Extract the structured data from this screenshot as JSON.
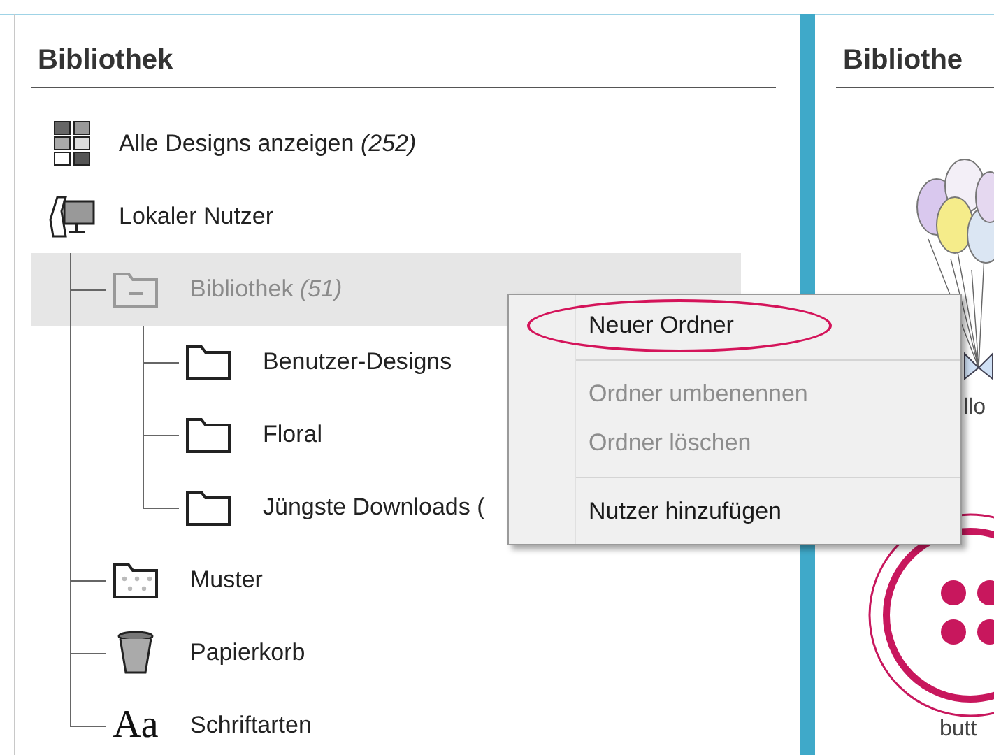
{
  "library_panel": {
    "title": "Bibliothek",
    "tree": [
      {
        "label": "Alle Designs anzeigen *(252)*",
        "kind": "grid",
        "selected": false
      },
      {
        "label": "Lokaler Nutzer",
        "kind": "computer",
        "selected": false,
        "children": [
          {
            "label": "Bibliothek *(51)*",
            "kind": "folder_minus",
            "selected": true,
            "children": [
              {
                "label": "Benutzer-Designs",
                "kind": "folder",
                "selected": false
              },
              {
                "label": "Floral",
                "kind": "folder",
                "selected": false
              },
              {
                "label": "Jüngste Downloads (",
                "kind": "folder",
                "selected": false
              }
            ]
          },
          {
            "label": "Muster",
            "kind": "pattern_folder",
            "selected": false
          },
          {
            "label": "Papierkorb",
            "kind": "trash",
            "selected": false
          },
          {
            "label": "Schriftarten",
            "kind": "font",
            "icon_text": "Aa",
            "selected": false
          }
        ]
      }
    ]
  },
  "designs_panel": {
    "title": "Bibliothe",
    "designs": [
      {
        "label": "llo",
        "kind": "balloons"
      },
      {
        "label": "butt",
        "kind": "button"
      }
    ]
  },
  "context_menu": [
    {
      "kind": "item",
      "label": "Neuer Ordner",
      "disabled": false,
      "circled": true
    },
    {
      "kind": "separator"
    },
    {
      "kind": "item",
      "label": "Ordner umbenennen",
      "disabled": true,
      "circled": false
    },
    {
      "kind": "item",
      "label": "Ordner löschen",
      "disabled": true,
      "circled": false
    },
    {
      "kind": "separator"
    },
    {
      "kind": "item",
      "label": "Nutzer hinzufügen",
      "disabled": false,
      "circled": false
    }
  ]
}
